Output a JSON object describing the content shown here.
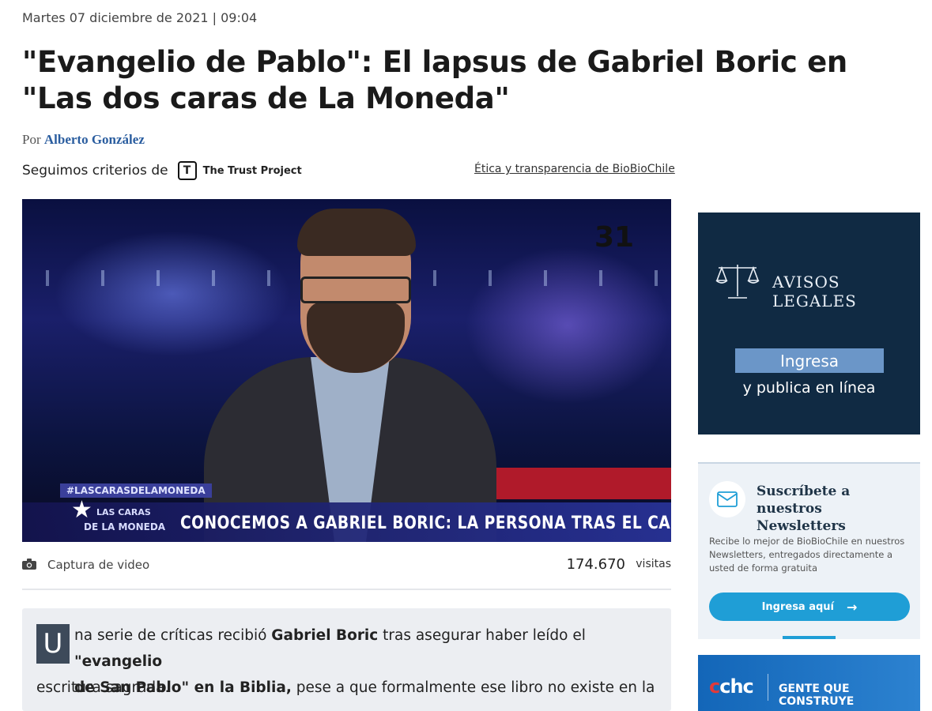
{
  "article": {
    "date": "Martes 07 diciembre de 2021 | 09:04",
    "headline": "\"Evangelio de Pablo\": El lapsus de Gabriel Boric en \"Las dos caras de La Moneda\"",
    "byline_prefix": "Por",
    "author": "Alberto González",
    "criteria_prefix": "Seguimos criterios de",
    "trust_logo_letter": "T",
    "trust_project": "The Trust Project",
    "ethics_link": "Ética y transparencia de BioBioChile"
  },
  "video": {
    "channel_logo": "31",
    "hashtag": "#LASCARASDELAMONEDA",
    "show_logo_line1": "LAS CARAS",
    "show_logo_line2": "DE LA MONEDA",
    "lower_third": "CONOCEMOS A GABRIEL BORIC: LA PERSONA TRAS EL CANDIDATO"
  },
  "photo_meta": {
    "icon": "camera-icon",
    "caption": "Captura de video",
    "visits_count": "174.670",
    "visits_label": "visitas"
  },
  "lead": {
    "dropcap": "U",
    "line1_a": "na serie de críticas recibió ",
    "line1_bold": "Gabriel Boric",
    "line1_b": " tras asegurar haber leído el ",
    "line1_bold2": "\"evangelio",
    "line2_bold": "de San Pablo\" en la Biblia,",
    "line2_b": " pese a que formalmente ese libro no existe en la",
    "line3": "escritura sagrada."
  },
  "ad_legal": {
    "icon": "scales-icon",
    "title": "AVISOS LEGALES",
    "button": "Ingresa",
    "subtitle": "y publica en línea",
    "bg_color": "#102a43",
    "button_color": "#6b96c8"
  },
  "newsletter": {
    "icon": "mail-icon",
    "title": "Suscríbete a nuestros Newsletters",
    "description": "Recibe lo mejor de BioBioChile en nuestros Newsletters, entregados directamente a usted de forma gratuita",
    "button": "Ingresa aquí",
    "button_icon": "arrow-right-icon",
    "accent_color": "#1f9ed6"
  },
  "cchc_ad": {
    "logo": "cchc",
    "slogan": "GENTE QUE CONSTRUYE"
  }
}
